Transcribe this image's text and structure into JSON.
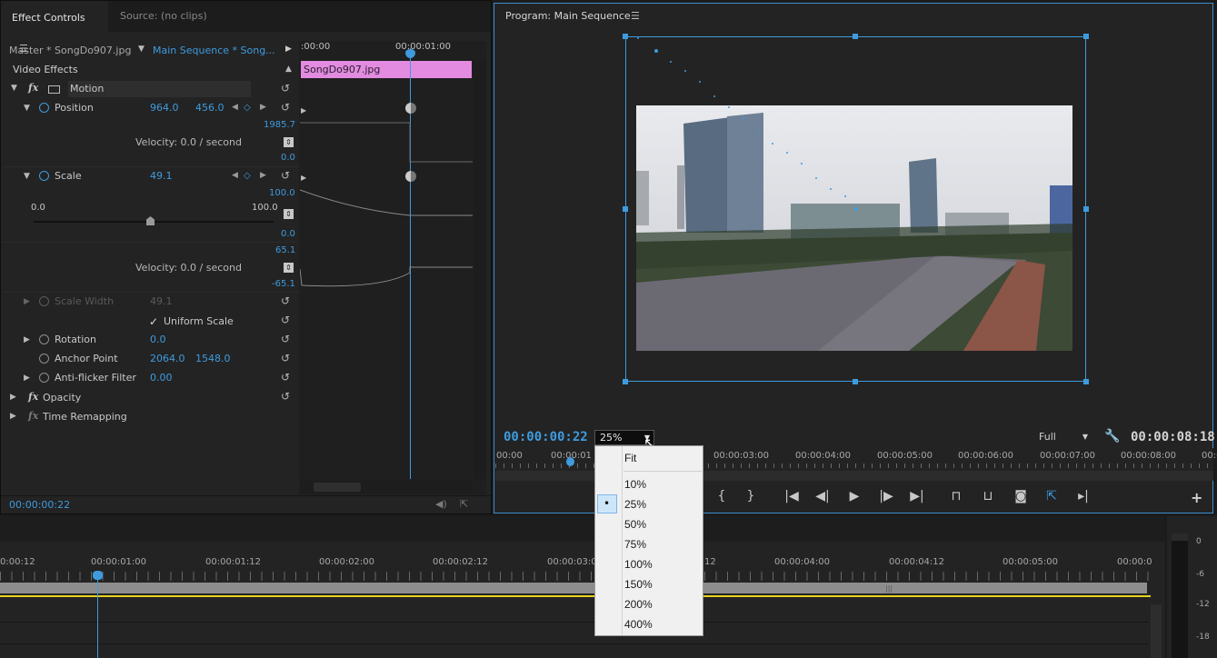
{
  "effect_controls": {
    "tab_active": "Effect Controls",
    "tab_inactive": "Source: (no clips)",
    "master_label": "Master * SongDo907.jpg",
    "sequence_label": "Main Sequence * Song...",
    "video_effects": "Video Effects",
    "motion_label": "Motion",
    "position_label": "Position",
    "position_x": "964.0",
    "position_y": "456.0",
    "position_graph_top": "1985.7",
    "position_velocity": "Velocity: 0.0 / second",
    "position_graph_bottom": "0.0",
    "scale_label": "Scale",
    "scale_value": "49.1",
    "scale_graph_top": "100.0",
    "scale_slider_min": "0.0",
    "scale_slider_max": "100.0",
    "scale_graph_mid": "0.0",
    "scale_vel_top": "65.1",
    "scale_velocity": "Velocity: 0.0 / second",
    "scale_vel_bottom": "-65.1",
    "scale_width_label": "Scale Width",
    "scale_width_value": "49.1",
    "uniform_scale": "Uniform Scale",
    "rotation_label": "Rotation",
    "rotation_value": "0.0",
    "anchor_label": "Anchor Point",
    "anchor_x": "2064.0",
    "anchor_y": "1548.0",
    "antiflicker_label": "Anti-flicker Filter",
    "antiflicker_value": "0.00",
    "opacity_label": "Opacity",
    "time_remap_label": "Time Remapping",
    "timecode": "00:00:00:22",
    "ruler_start": ":00:00",
    "ruler_mark": "00:00:01:00",
    "clip_name": "SongDo907.jpg",
    "fx_glyph": "fx"
  },
  "program": {
    "title": "Program: Main Sequence",
    "timecode_current": "00:00:00:22",
    "zoom_value": "25%",
    "resolution": "Full",
    "timecode_duration": "00:00:08:18",
    "ruler_labels": [
      "00:00",
      "00:00:01",
      "00:00:03:00",
      "00:00:04:00",
      "00:00:05:00",
      "00:00:06:00",
      "00:00:07:00",
      "00:00:08:00",
      "00:0"
    ]
  },
  "zoom_menu": {
    "items": [
      "Fit",
      "10%",
      "25%",
      "50%",
      "75%",
      "100%",
      "150%",
      "200%",
      "400%"
    ],
    "selected": "25%"
  },
  "bottom_timeline": {
    "ruler_labels": [
      "0:00:12",
      "00:00:01:00",
      "00:00:01:12",
      "00:00:02:00",
      "00:00:02:12",
      "00:00:03:0",
      "12",
      "00:00:04:00",
      "00:00:04:12",
      "00:00:05:00",
      "00:00:0"
    ]
  },
  "audio_meter": {
    "labels": [
      "0",
      "-6",
      "-12",
      "-18"
    ]
  },
  "colors": {
    "accent": "#3e9bde",
    "clip": "#e28be0",
    "panel": "#232323",
    "timeline_yellow": "#e6d21d"
  }
}
